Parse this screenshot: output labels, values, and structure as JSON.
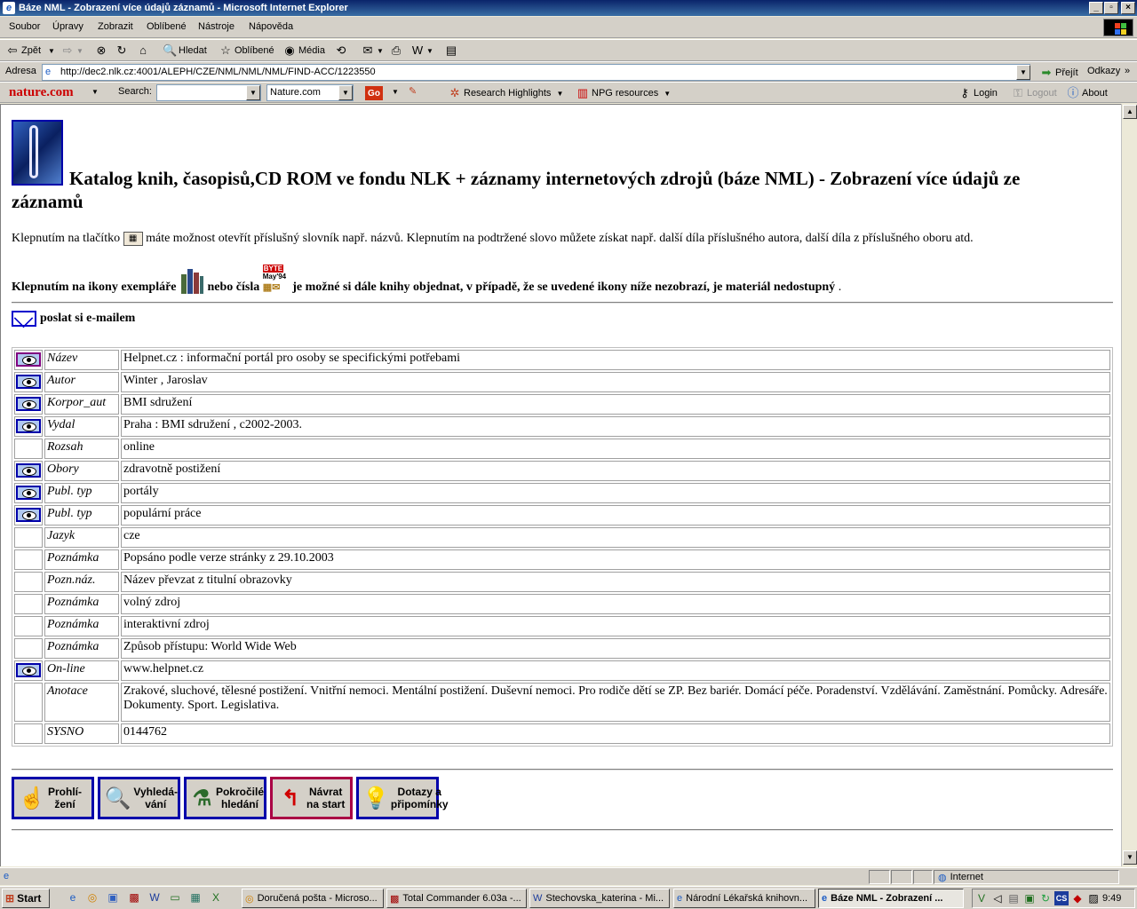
{
  "window": {
    "title": "Báze NML - Zobrazení více údajů záznamů - Microsoft Internet Explorer"
  },
  "menu": [
    "Soubor",
    "Úpravy",
    "Zobrazit",
    "Oblíbené",
    "Nástroje",
    "Nápověda"
  ],
  "toolbar": {
    "back": "Zpět",
    "search": "Hledat",
    "favorites": "Oblíbené",
    "media": "Média"
  },
  "address": {
    "label": "Adresa",
    "url": "http://dec2.nlk.cz:4001/ALEPH/CZE/NML/NML/NML/FIND-ACC/1223550",
    "go": "Přejít",
    "links": "Odkazy"
  },
  "nature_bar": {
    "brand": "nature.com",
    "search_label": "Search:",
    "search_value": "",
    "scope": "Nature.com",
    "go": "Go",
    "research": "Research Highlights",
    "npg": "NPG resources",
    "login": "Login",
    "logout": "Logout",
    "about": "About"
  },
  "page": {
    "heading": "Katalog knih, časopisů,CD ROM ve fondu NLK + záznamy internetových zdrojů (báze NML) - Zobrazení více údajů ze záznamů",
    "p1_a": "Klepnutím na tlačítko",
    "p1_b": "máte možnost otevřít příslušný slovník např. názvů. Klepnutím na podtržené slovo můžete získat např. další díla příslušného autora, další díla z příslušného oboru atd.",
    "p2_a": "Klepnutím na ikony exempláře",
    "p2_b": "nebo čísla",
    "p2_c": "je možné si dále knihy objednat, v případě, že se uvedené ikony níže nezobrazí, je materiál nedostupný",
    "p2_d": ".",
    "byte_top": "BYTE",
    "byte_bottom": "May'94",
    "mail": "poslat si e-mailem"
  },
  "record": [
    {
      "icon": true,
      "label": "Název",
      "value": "Helpnet.cz : informační portál pro osoby se specifickými potřebami"
    },
    {
      "icon": true,
      "label": "Autor",
      "value": "Winter , Jaroslav"
    },
    {
      "icon": true,
      "label": "Korpor_aut",
      "value": "BMI sdružení"
    },
    {
      "icon": true,
      "label": "Vydal",
      "value": "Praha : BMI sdružení , c2002-2003."
    },
    {
      "icon": false,
      "label": "Rozsah",
      "value": "online"
    },
    {
      "icon": true,
      "label": "Obory",
      "value": "zdravotně postižení"
    },
    {
      "icon": true,
      "label": "Publ. typ",
      "value": "portály"
    },
    {
      "icon": true,
      "label": "Publ. typ",
      "value": "populární práce"
    },
    {
      "icon": false,
      "label": "Jazyk",
      "value": "cze"
    },
    {
      "icon": false,
      "label": "Poznámka",
      "value": "Popsáno podle verze stránky z 29.10.2003"
    },
    {
      "icon": false,
      "label": "Pozn.náz.",
      "value": "Název převzat z titulní obrazovky"
    },
    {
      "icon": false,
      "label": "Poznámka",
      "value": "volný zdroj"
    },
    {
      "icon": false,
      "label": "Poznámka",
      "value": "interaktivní zdroj"
    },
    {
      "icon": false,
      "label": "Poznámka",
      "value": "Způsob přístupu: World Wide Web"
    },
    {
      "icon": true,
      "label": "On-line",
      "value": "www.helpnet.cz"
    },
    {
      "icon": false,
      "label": "Anotace",
      "value": "Zrakové, sluchové, tělesné postižení. Vnitřní nemoci. Mentální postižení. Duševní nemoci. Pro rodiče dětí se ZP. Bez bariér. Domácí péče. Poradenství. Vzdělávání. Zaměstnání. Pomůcky. Adresáře. Dokumenty. Sport. Legislativa."
    },
    {
      "icon": false,
      "label": "SYSNO",
      "value": "0144762"
    }
  ],
  "nav_buttons": [
    {
      "l1": "Prohlí-",
      "l2": "žení",
      "icon": "hand-icon"
    },
    {
      "l1": "Vyhledá-",
      "l2": "vání",
      "icon": "magnifier-icon"
    },
    {
      "l1": "Pokročilé",
      "l2": "hledání",
      "icon": "microscope-icon"
    },
    {
      "l1": "Návrat",
      "l2": "na start",
      "icon": "return-arrow-icon"
    },
    {
      "l1": "Dotazy a",
      "l2": "připomínky",
      "icon": "bulb-icon"
    }
  ],
  "status": {
    "zone": "Internet"
  },
  "taskbar": {
    "start": "Start",
    "tasks": [
      "Doručená pošta - Microso...",
      "Total Commander 6.03a -...",
      "Stechovska_katerina - Mi...",
      "Národní Lékařská knihovn...",
      "Báze NML - Zobrazení ..."
    ],
    "lang": "CS",
    "clock": "9:49"
  }
}
